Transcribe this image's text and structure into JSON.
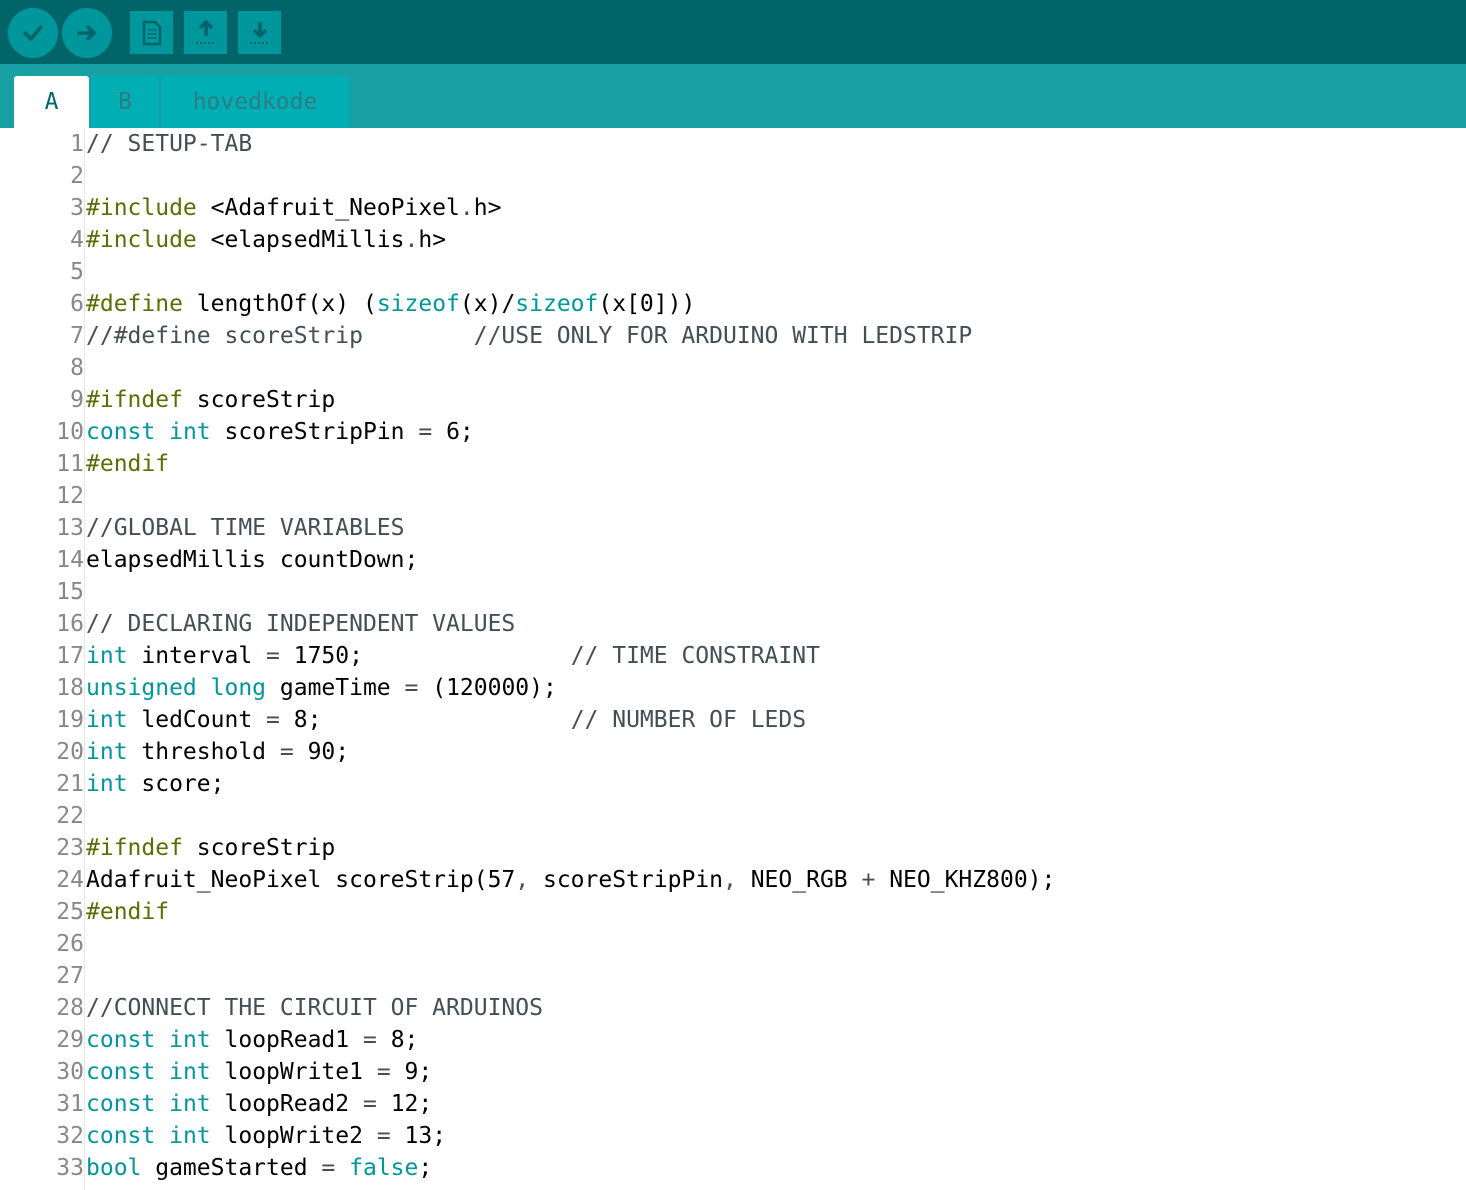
{
  "toolbar": {
    "buttons": [
      {
        "name": "verify-button",
        "icon": "checkmark-icon",
        "shape": "round"
      },
      {
        "name": "upload-button",
        "icon": "arrow-right-icon",
        "shape": "round"
      },
      {
        "name": "new-button",
        "icon": "new-file-icon",
        "shape": "square"
      },
      {
        "name": "open-button",
        "icon": "open-up-arrow-icon",
        "shape": "square"
      },
      {
        "name": "save-button",
        "icon": "save-down-arrow-icon",
        "shape": "square"
      }
    ]
  },
  "tabs": [
    {
      "label": "A",
      "active": true
    },
    {
      "label": "B",
      "active": false
    },
    {
      "label": "hovedkode",
      "active": false
    }
  ],
  "colors": {
    "toolbar_bg": "#006468",
    "tabbar_bg": "#17a1a5",
    "keyword": "#00979c",
    "preprocessor": "#5e6d03",
    "comment": "#434f54"
  },
  "editor": {
    "lines": [
      {
        "n": "1",
        "tokens": [
          {
            "t": "// SETUP-TAB",
            "k": "comment"
          }
        ]
      },
      {
        "n": "2",
        "tokens": []
      },
      {
        "n": "3",
        "tokens": [
          {
            "t": "#include",
            "k": "pre"
          },
          {
            "t": " <Adafruit_NeoPixel",
            "k": "text"
          },
          {
            "t": ".",
            "k": "op"
          },
          {
            "t": "h>",
            "k": "text"
          }
        ]
      },
      {
        "n": "4",
        "tokens": [
          {
            "t": "#include",
            "k": "pre"
          },
          {
            "t": " <elapsedMillis",
            "k": "text"
          },
          {
            "t": ".",
            "k": "op"
          },
          {
            "t": "h>",
            "k": "text"
          }
        ]
      },
      {
        "n": "5",
        "tokens": []
      },
      {
        "n": "6",
        "tokens": [
          {
            "t": "#define",
            "k": "pre"
          },
          {
            "t": " lengthOf(x) (",
            "k": "text"
          },
          {
            "t": "sizeof",
            "k": "kw"
          },
          {
            "t": "(x)/",
            "k": "text"
          },
          {
            "t": "sizeof",
            "k": "kw"
          },
          {
            "t": "(x[0]))",
            "k": "text"
          }
        ]
      },
      {
        "n": "7",
        "tokens": [
          {
            "t": "//#define scoreStrip        //USE ONLY FOR ARDUINO WITH LEDSTRIP",
            "k": "comment"
          }
        ]
      },
      {
        "n": "8",
        "tokens": []
      },
      {
        "n": "9",
        "tokens": [
          {
            "t": "#ifndef",
            "k": "pre"
          },
          {
            "t": " scoreStrip",
            "k": "text"
          }
        ]
      },
      {
        "n": "10",
        "tokens": [
          {
            "t": "const",
            "k": "kw"
          },
          {
            "t": " ",
            "k": "text"
          },
          {
            "t": "int",
            "k": "kw"
          },
          {
            "t": " scoreStripPin ",
            "k": "text"
          },
          {
            "t": "=",
            "k": "op"
          },
          {
            "t": " 6;",
            "k": "text"
          }
        ]
      },
      {
        "n": "11",
        "tokens": [
          {
            "t": "#endif",
            "k": "pre"
          }
        ]
      },
      {
        "n": "12",
        "tokens": []
      },
      {
        "n": "13",
        "tokens": [
          {
            "t": "//GLOBAL TIME VARIABLES",
            "k": "comment"
          }
        ]
      },
      {
        "n": "14",
        "tokens": [
          {
            "t": "elapsedMillis countDown;",
            "k": "text"
          }
        ]
      },
      {
        "n": "15",
        "tokens": []
      },
      {
        "n": "16",
        "tokens": [
          {
            "t": "// DECLARING INDEPENDENT VALUES",
            "k": "comment"
          }
        ]
      },
      {
        "n": "17",
        "tokens": [
          {
            "t": "int",
            "k": "kw"
          },
          {
            "t": " interval ",
            "k": "text"
          },
          {
            "t": "=",
            "k": "op"
          },
          {
            "t": " 1750;               ",
            "k": "text"
          },
          {
            "t": "// TIME CONSTRAINT",
            "k": "comment"
          }
        ]
      },
      {
        "n": "18",
        "tokens": [
          {
            "t": "unsigned",
            "k": "kw"
          },
          {
            "t": " ",
            "k": "text"
          },
          {
            "t": "long",
            "k": "kw"
          },
          {
            "t": " gameTime ",
            "k": "text"
          },
          {
            "t": "=",
            "k": "op"
          },
          {
            "t": " (120000);",
            "k": "text"
          }
        ]
      },
      {
        "n": "19",
        "tokens": [
          {
            "t": "int",
            "k": "kw"
          },
          {
            "t": " ledCount ",
            "k": "text"
          },
          {
            "t": "=",
            "k": "op"
          },
          {
            "t": " 8;                  ",
            "k": "text"
          },
          {
            "t": "// NUMBER OF LEDS",
            "k": "comment"
          }
        ]
      },
      {
        "n": "20",
        "tokens": [
          {
            "t": "int",
            "k": "kw"
          },
          {
            "t": " threshold ",
            "k": "text"
          },
          {
            "t": "=",
            "k": "op"
          },
          {
            "t": " 90;",
            "k": "text"
          }
        ]
      },
      {
        "n": "21",
        "tokens": [
          {
            "t": "int",
            "k": "kw"
          },
          {
            "t": " score;",
            "k": "text"
          }
        ]
      },
      {
        "n": "22",
        "tokens": []
      },
      {
        "n": "23",
        "tokens": [
          {
            "t": "#ifndef",
            "k": "pre"
          },
          {
            "t": " scoreStrip",
            "k": "text"
          }
        ]
      },
      {
        "n": "24",
        "tokens": [
          {
            "t": "Adafruit_NeoPixel scoreStrip(57",
            "k": "text"
          },
          {
            "t": ",",
            "k": "op"
          },
          {
            "t": " scoreStripPin",
            "k": "text"
          },
          {
            "t": ",",
            "k": "op"
          },
          {
            "t": " NEO_RGB ",
            "k": "text"
          },
          {
            "t": "+",
            "k": "op"
          },
          {
            "t": " NEO_KHZ800);",
            "k": "text"
          }
        ]
      },
      {
        "n": "25",
        "tokens": [
          {
            "t": "#endif",
            "k": "pre"
          }
        ]
      },
      {
        "n": "26",
        "tokens": []
      },
      {
        "n": "27",
        "tokens": []
      },
      {
        "n": "28",
        "tokens": [
          {
            "t": "//CONNECT THE CIRCUIT OF ARDUINOS",
            "k": "comment"
          }
        ]
      },
      {
        "n": "29",
        "tokens": [
          {
            "t": "const",
            "k": "kw"
          },
          {
            "t": " ",
            "k": "text"
          },
          {
            "t": "int",
            "k": "kw"
          },
          {
            "t": " loopRead1 ",
            "k": "text"
          },
          {
            "t": "=",
            "k": "op"
          },
          {
            "t": " 8;",
            "k": "text"
          }
        ]
      },
      {
        "n": "30",
        "tokens": [
          {
            "t": "const",
            "k": "kw"
          },
          {
            "t": " ",
            "k": "text"
          },
          {
            "t": "int",
            "k": "kw"
          },
          {
            "t": " loopWrite1 ",
            "k": "text"
          },
          {
            "t": "=",
            "k": "op"
          },
          {
            "t": " 9;",
            "k": "text"
          }
        ]
      },
      {
        "n": "31",
        "tokens": [
          {
            "t": "const",
            "k": "kw"
          },
          {
            "t": " ",
            "k": "text"
          },
          {
            "t": "int",
            "k": "kw"
          },
          {
            "t": " loopRead2 ",
            "k": "text"
          },
          {
            "t": "=",
            "k": "op"
          },
          {
            "t": " 12;",
            "k": "text"
          }
        ]
      },
      {
        "n": "32",
        "tokens": [
          {
            "t": "const",
            "k": "kw"
          },
          {
            "t": " ",
            "k": "text"
          },
          {
            "t": "int",
            "k": "kw"
          },
          {
            "t": " loopWrite2 ",
            "k": "text"
          },
          {
            "t": "=",
            "k": "op"
          },
          {
            "t": " 13;",
            "k": "text"
          }
        ]
      },
      {
        "n": "33",
        "tokens": [
          {
            "t": "bool",
            "k": "kw"
          },
          {
            "t": " gameStarted ",
            "k": "text"
          },
          {
            "t": "=",
            "k": "op"
          },
          {
            "t": " ",
            "k": "text"
          },
          {
            "t": "false",
            "k": "kw"
          },
          {
            "t": ";",
            "k": "text"
          }
        ]
      }
    ]
  }
}
